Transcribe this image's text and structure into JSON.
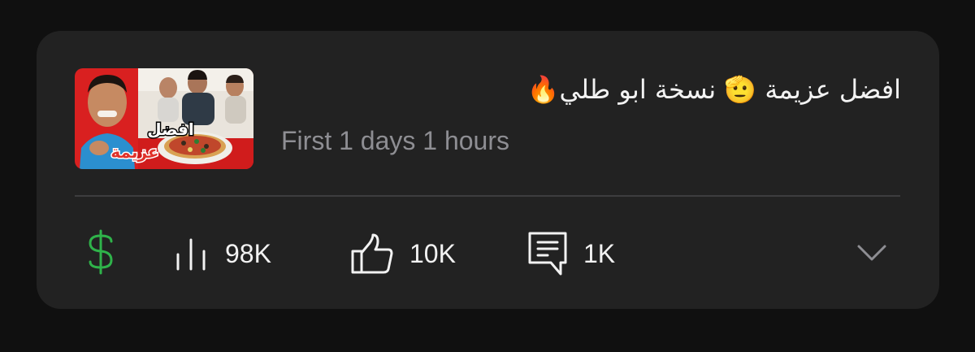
{
  "video": {
    "title": "افضل عزيمة 🫡 نسخة ابو طلي🔥",
    "subtitle": "First 1 days 1 hours",
    "thumbnail_text_line1": "افضل",
    "thumbnail_text_line2": "عزيمة"
  },
  "stats": {
    "views": "98K",
    "likes": "10K",
    "comments": "1K"
  },
  "icons": {
    "monetization": "dollar-icon",
    "views": "bar-chart-icon",
    "likes": "thumbs-up-icon",
    "comments": "comment-icon",
    "expand": "chevron-down-icon"
  },
  "colors": {
    "card_background": "#222222",
    "page_background": "#101010",
    "monetization_green": "#2fb34a",
    "secondary_text": "#8e8e93"
  }
}
